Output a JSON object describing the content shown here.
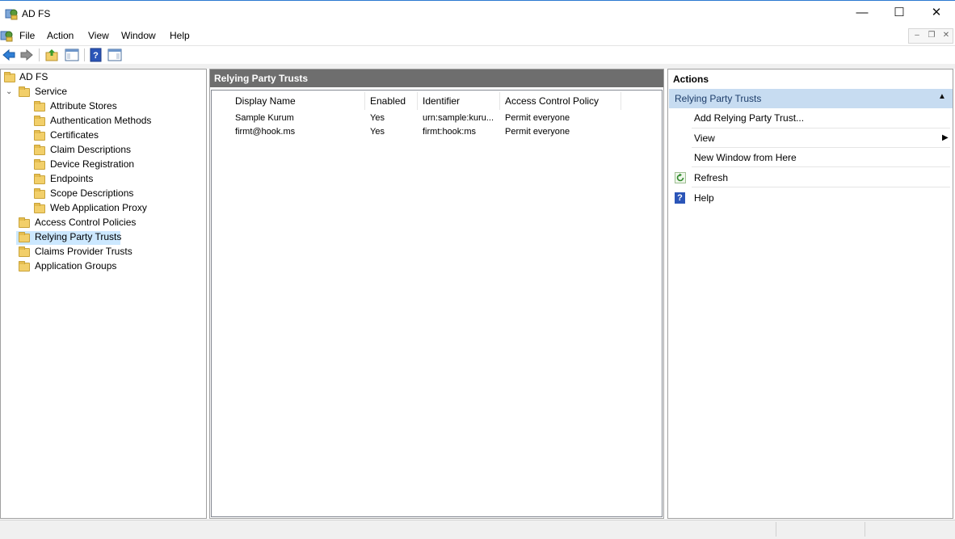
{
  "window": {
    "title": "AD FS",
    "min_glyph": "—",
    "max_glyph": "☐",
    "close_glyph": "✕"
  },
  "menu": {
    "items": [
      "File",
      "Action",
      "View",
      "Window",
      "Help"
    ]
  },
  "tree": {
    "root": "AD FS",
    "service": "Service",
    "service_children": [
      "Attribute Stores",
      "Authentication Methods",
      "Certificates",
      "Claim Descriptions",
      "Device Registration",
      "Endpoints",
      "Scope Descriptions",
      "Web Application Proxy"
    ],
    "top_level": [
      "Access Control Policies",
      "Relying Party Trusts",
      "Claims Provider Trusts",
      "Application Groups"
    ],
    "selected": "Relying Party Trusts"
  },
  "center": {
    "title": "Relying Party Trusts",
    "columns": [
      "Display Name",
      "Enabled",
      "Identifier",
      "Access Control Policy"
    ],
    "rows": [
      [
        "Sample Kurum",
        "Yes",
        "urn:sample:kuru...",
        "Permit everyone"
      ],
      [
        "firmt@hook.ms",
        "Yes",
        "firmt:hook:ms",
        "Permit everyone"
      ]
    ]
  },
  "actions": {
    "title": "Actions",
    "group": "Relying Party Trusts",
    "items": [
      "Add Relying Party Trust...",
      "View",
      "New Window from Here",
      "Refresh",
      "Help"
    ]
  },
  "colors": {
    "selection": "#cce8ff",
    "header_bar": "#6e6e6e",
    "actions_group": "#c7dcf1"
  }
}
